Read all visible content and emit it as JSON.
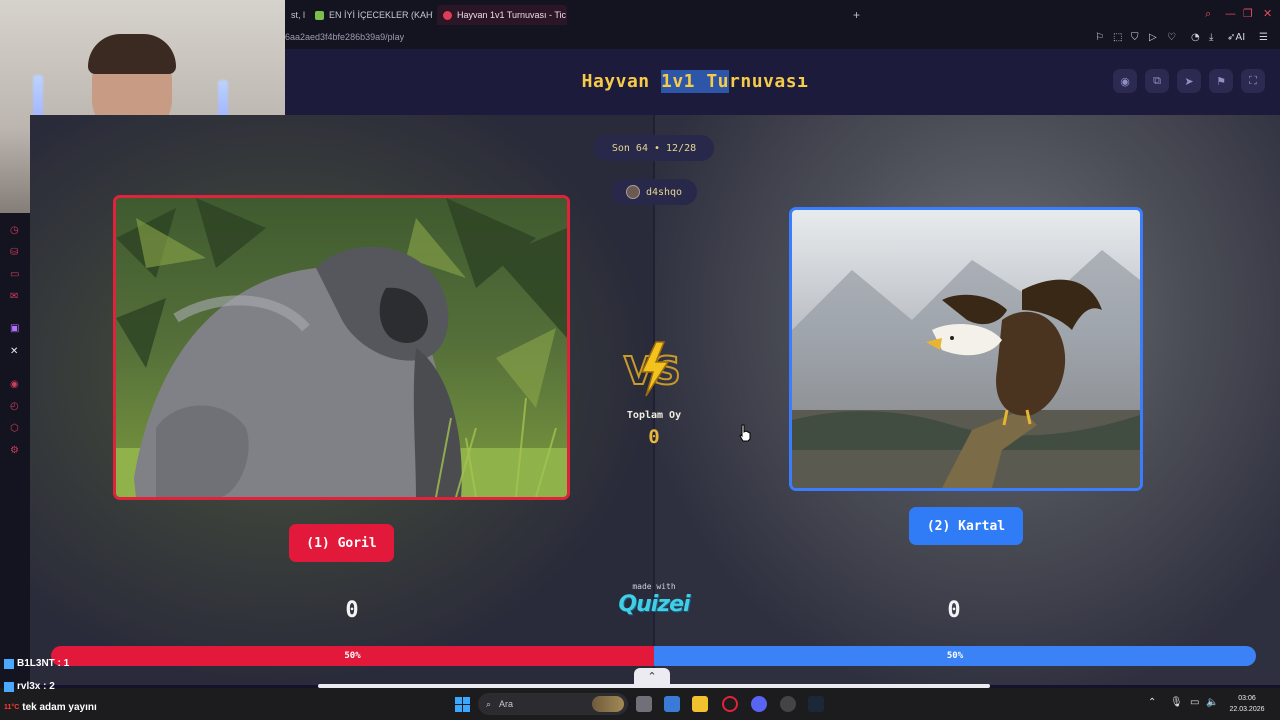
{
  "browser": {
    "tabs": [
      {
        "label": "st, l",
        "color": "#6b6b6b",
        "active": false
      },
      {
        "label": "EN İYİ İÇECEKLER (KAHVE",
        "color": "#7bbf4a",
        "active": false
      },
      {
        "label": "Hayvan 1v1 Turnuvası - Tic",
        "color": "#e23b54",
        "active": true
      }
    ],
    "new_tab_label": "+",
    "url": "6aa2aed3f4bfe286b39a9/play",
    "toolbar_icons": [
      "bookmark-icon",
      "screenshot-icon",
      "shield-icon",
      "play-icon",
      "heart-icon",
      "profile-icon",
      "download-icon",
      "ai-icon",
      "menu-icon"
    ],
    "ai_label": "AI"
  },
  "page": {
    "title_before": "Hayvan ",
    "title_highlight": "1v1 Tu",
    "title_after": "rnuvası",
    "header_buttons": [
      "eye-icon",
      "copy-icon",
      "send-icon",
      "flag-icon",
      "fullscreen-icon"
    ],
    "round_label": "Son 64 • 12/28",
    "username": "d4shqo",
    "vs_label": "VS",
    "total_label": "Toplam Oy",
    "total_value": "0",
    "made_with": "made with",
    "brand": "Quizei",
    "left": {
      "button_label": "(1) Goril",
      "score": "0",
      "percent": "50%",
      "accent": "#e3193b",
      "image": "gorilla"
    },
    "right": {
      "button_label": "(2) Kartal",
      "score": "0",
      "percent": "50%",
      "accent": "#3b82f6",
      "image": "eagle"
    },
    "vote_share_left": 0.5
  },
  "stream_overlay": {
    "lines": [
      "B1L3NT : 1",
      "rvl3x : 2",
      "tek adam yayını"
    ],
    "weather": "11°C"
  },
  "taskbar": {
    "search_placeholder": "Ara",
    "time": "03:06",
    "date": "22.03.2026"
  }
}
